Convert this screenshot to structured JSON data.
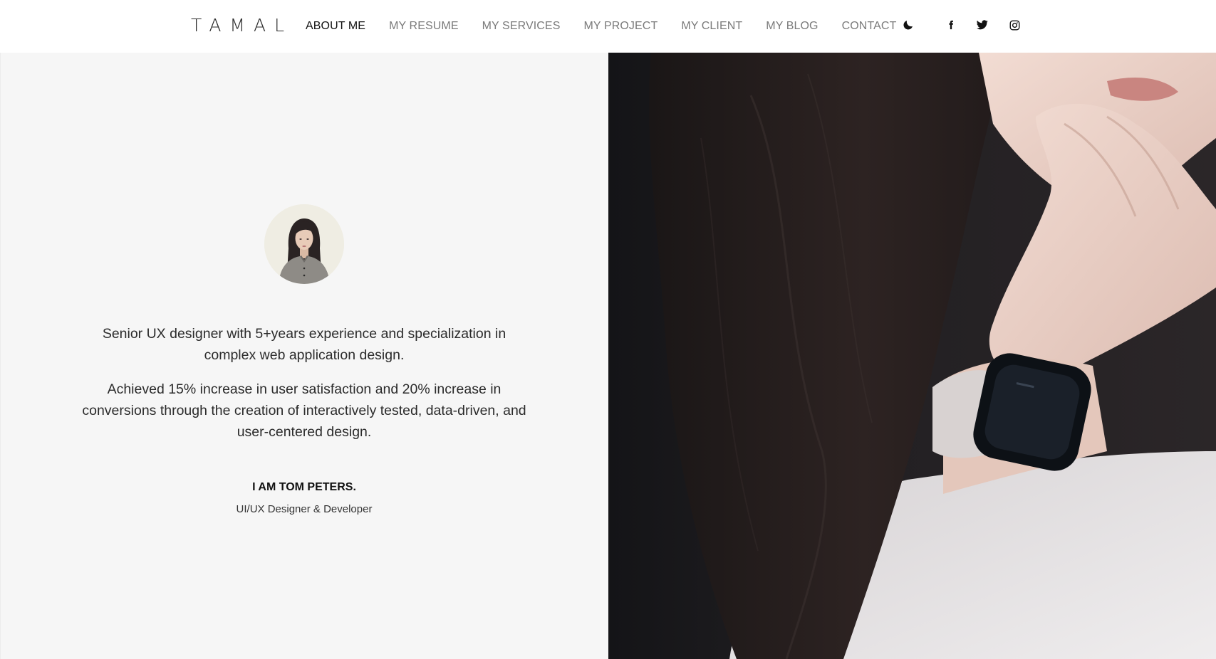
{
  "header": {
    "logo": "TAMAL",
    "nav": [
      {
        "label": "ABOUT ME",
        "active": true
      },
      {
        "label": "MY RESUME",
        "active": false
      },
      {
        "label": "MY SERVICES",
        "active": false
      },
      {
        "label": "MY PROJECT",
        "active": false
      },
      {
        "label": "MY CLIENT",
        "active": false
      },
      {
        "label": "MY BLOG",
        "active": false
      },
      {
        "label": "CONTACT",
        "active": false
      }
    ],
    "icons": [
      "moon-icon",
      "facebook-icon",
      "twitter-icon",
      "instagram-icon"
    ]
  },
  "about": {
    "bio_1": "Senior UX designer with 5+years experience and specialization in complex web application design.",
    "bio_2": "Achieved 15% increase in user satisfaction and 20% increase in conversions through the creation of interactively tested, data-driven, and user-centered design.",
    "name": "I AM TOM PETERS.",
    "role": "UI/UX Designer & Developer"
  },
  "colors": {
    "accent_text": "#111111",
    "muted_nav": "#7a7a7a",
    "panel_bg": "#f6f6f6"
  }
}
